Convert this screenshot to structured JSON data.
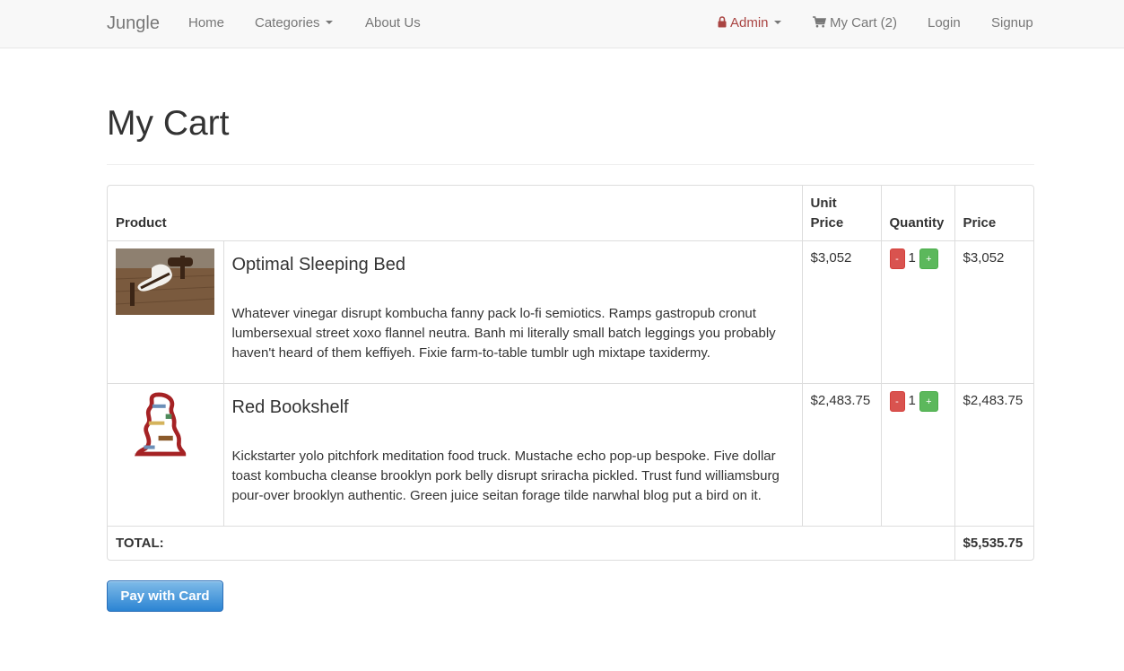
{
  "navbar": {
    "brand": "Jungle",
    "home": "Home",
    "categories": "Categories",
    "about": "About Us",
    "admin": "Admin",
    "cart": "My Cart (2)",
    "login": "Login",
    "signup": "Signup",
    "icons": {
      "admin": "lock-icon",
      "cart": "shopping-cart-icon",
      "dropdown": "caret-down-icon"
    },
    "colors": {
      "background": "#f8f8f8",
      "link": "#777777",
      "admin": "#a94442"
    }
  },
  "page": {
    "title": "My Cart"
  },
  "table": {
    "headers": {
      "product": "Product",
      "unit_price_line1": "Unit",
      "unit_price_line2": "Price",
      "quantity": "Quantity",
      "price": "Price"
    },
    "items": [
      {
        "name": "Optimal Sleeping Bed",
        "description": "Whatever vinegar disrupt kombucha fanny pack lo-fi semiotics. Ramps gastropub cronut lumbersexual street xoxo flannel neutra. Banh mi literally small batch leggings you probably haven't heard of them keffiyeh. Fixie farm-to-table tumblr ugh mixtape taxidermy.",
        "unit_price": "$3,052",
        "quantity": "1",
        "price": "$3,052",
        "minus_label": "-",
        "plus_label": "+"
      },
      {
        "name": "Red Bookshelf",
        "description": "Kickstarter yolo pitchfork meditation food truck. Mustache echo pop-up bespoke. Five dollar toast kombucha cleanse brooklyn pork belly disrupt sriracha pickled. Trust fund williamsburg pour-over brooklyn authentic. Green juice seitan forage tilde narwhal blog put a bird on it.",
        "unit_price": "$2,483.75",
        "quantity": "1",
        "price": "$2,483.75",
        "minus_label": "-",
        "plus_label": "+"
      }
    ],
    "total_label": "TOTAL:",
    "total_value": "$5,535.75",
    "colors": {
      "minus": "#d9534f",
      "plus": "#5cb85c",
      "border": "#dddddd"
    }
  },
  "actions": {
    "pay_label": "Pay with Card",
    "pay_color": "#2b84d3"
  }
}
